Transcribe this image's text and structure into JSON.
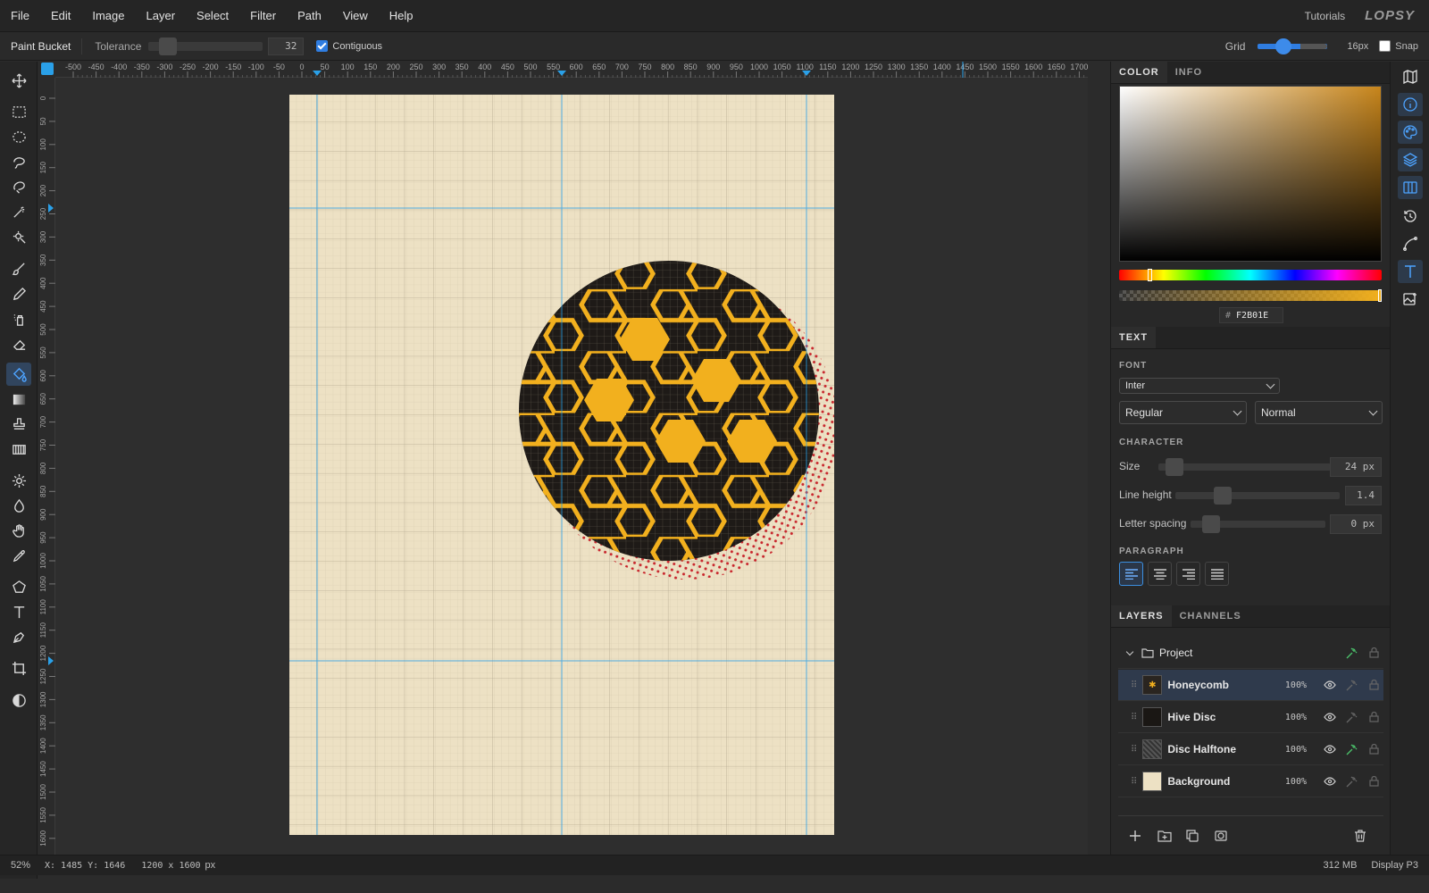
{
  "menu": {
    "items": [
      "File",
      "Edit",
      "Image",
      "Layer",
      "Select",
      "Filter",
      "Path",
      "View",
      "Help"
    ],
    "tutorials": "Tutorials",
    "logo": "LOPSY"
  },
  "options": {
    "tool_name": "Paint Bucket",
    "tolerance_label": "Tolerance",
    "tolerance_value": "32",
    "contiguous_label": "Contiguous",
    "contiguous_checked": true,
    "grid_label": "Grid",
    "grid_value": "16px",
    "snap_label": "Snap",
    "snap_checked": false
  },
  "tools": [
    {
      "icon": "move-icon"
    },
    {
      "icon": "rect-select-icon"
    },
    {
      "icon": "ellipse-select-icon"
    },
    {
      "icon": "lasso-icon"
    },
    {
      "icon": "magnetic-lasso-icon"
    },
    {
      "icon": "magic-wand-icon"
    },
    {
      "icon": "quick-select-icon"
    },
    {
      "icon": "brush-icon"
    },
    {
      "icon": "pencil-icon"
    },
    {
      "icon": "spray-icon"
    },
    {
      "icon": "eraser-icon"
    },
    {
      "icon": "paint-bucket-icon",
      "active": true
    },
    {
      "icon": "gradient-icon"
    },
    {
      "icon": "stamp-icon"
    },
    {
      "icon": "pattern-icon"
    },
    {
      "icon": "dodge-icon"
    },
    {
      "icon": "blur-icon"
    },
    {
      "icon": "hand-icon"
    },
    {
      "icon": "eyedropper-icon"
    },
    {
      "icon": "shape-icon"
    },
    {
      "icon": "text-icon"
    },
    {
      "icon": "pen-icon"
    },
    {
      "icon": "crop-icon"
    },
    {
      "icon": "contrast-icon"
    }
  ],
  "ruler": {
    "h_ticks": [
      "-500",
      "-450",
      "-400",
      "-350",
      "-300",
      "-250",
      "-200",
      "-150",
      "-100",
      "-50",
      "0",
      "50",
      "100",
      "150",
      "200",
      "250",
      "300",
      "350",
      "400",
      "450",
      "500",
      "550",
      "600",
      "650",
      "700",
      "750",
      "800",
      "850",
      "900",
      "950",
      "1000",
      "1050",
      "1100",
      "1150",
      "1200",
      "1250",
      "1300",
      "1350",
      "1400",
      "1450",
      "1500",
      "1550",
      "1600",
      "1650",
      "1700"
    ],
    "v_ticks": [
      "0",
      "50",
      "100",
      "150",
      "200",
      "250",
      "300",
      "350",
      "400",
      "450",
      "500",
      "550",
      "600",
      "650",
      "700",
      "750",
      "800",
      "850",
      "900",
      "950",
      "1000",
      "1050",
      "1100",
      "1150",
      "1200",
      "1250",
      "1300",
      "1350",
      "1400",
      "1450",
      "1500",
      "1550",
      "1600",
      "50"
    ]
  },
  "status": {
    "zoom": "52%",
    "coords": "X: 1485 Y: 1646",
    "doc_size": "1200 x 1600",
    "doc_unit": "px",
    "memory": "312 MB",
    "color_profile": "Display P3"
  },
  "color_panel": {
    "tabs": [
      "COLOR",
      "INFO"
    ],
    "hex_prefix": "#",
    "hex": "F2B01E",
    "accent": "#F2B01E"
  },
  "text_panel": {
    "tab": "TEXT",
    "font_title": "FONT",
    "font_family": "Inter",
    "font_weight": "Regular",
    "font_style": "Normal",
    "character_title": "CHARACTER",
    "size_label": "Size",
    "size_value": "24 px",
    "line_height_label": "Line height",
    "line_height_value": "1.4",
    "letter_spacing_label": "Letter spacing",
    "letter_spacing_value": "0 px",
    "paragraph_title": "PARAGRAPH"
  },
  "layers_panel": {
    "tabs": [
      "LAYERS",
      "CHANNELS"
    ],
    "group": {
      "name": "Project"
    },
    "layers": [
      {
        "name": "Honeycomb",
        "opacity": "100%",
        "selected": true
      },
      {
        "name": "Hive Disc",
        "opacity": "100%"
      },
      {
        "name": "Disc Halftone",
        "opacity": "100%"
      },
      {
        "name": "Background",
        "opacity": "100%"
      }
    ]
  },
  "colors": {
    "canvas_bg": "#EDE1C4",
    "honey": "#F2B01E",
    "disc": "#1E1A17",
    "halftone": "#C8252C",
    "guide": "#2AA0E8"
  }
}
